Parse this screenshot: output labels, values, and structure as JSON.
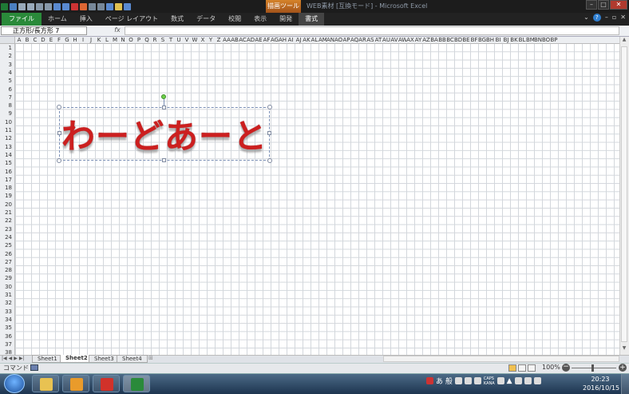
{
  "window": {
    "title": "WEB素材 [互換モード] - Microsoft Excel",
    "context_tab": "描画ツール"
  },
  "ribbon_tabs": [
    "ファイル",
    "ホーム",
    "挿入",
    "ページ レイアウト",
    "数式",
    "データ",
    "校閲",
    "表示",
    "開発",
    "書式"
  ],
  "formula_bar": {
    "name_box": "正方形/長方形 7",
    "fx": "fx",
    "value": ""
  },
  "columns": [
    "A",
    "B",
    "C",
    "D",
    "E",
    "F",
    "G",
    "H",
    "I",
    "J",
    "K",
    "L",
    "M",
    "N",
    "O",
    "P",
    "Q",
    "R",
    "S",
    "T",
    "U",
    "V",
    "W",
    "X",
    "Y",
    "Z",
    "AA",
    "AB",
    "AC",
    "AD",
    "AE",
    "AF",
    "AG",
    "AH",
    "AI",
    "AJ",
    "AK",
    "AL",
    "AM",
    "AN",
    "AO",
    "AP",
    "AQ",
    "AR",
    "AS",
    "AT",
    "AU",
    "AV",
    "AW",
    "AX",
    "AY",
    "AZ",
    "BA",
    "BB",
    "BC",
    "BD",
    "BE",
    "BF",
    "BG",
    "BH",
    "BI",
    "BJ",
    "BK",
    "BL",
    "BM",
    "BN",
    "BO",
    "BP"
  ],
  "rows": [
    "1",
    "2",
    "3",
    "4",
    "5",
    "6",
    "7",
    "8",
    "9",
    "10",
    "11",
    "12",
    "13",
    "14",
    "15",
    "16",
    "17",
    "18",
    "19",
    "20",
    "21",
    "22",
    "23",
    "24",
    "25",
    "26",
    "27",
    "28",
    "29",
    "30",
    "31",
    "32",
    "33",
    "34",
    "35",
    "36",
    "37",
    "38"
  ],
  "wordart": {
    "text": "わーどあーと",
    "color": "#cc1f1f"
  },
  "sheet_tabs": [
    "Sheet1",
    "Sheet2",
    "Sheet3",
    "Sheet4"
  ],
  "active_sheet": "Sheet2",
  "status": {
    "mode": "コマンド",
    "zoom": "100%"
  },
  "taskbar": {
    "time": "20:23",
    "date": "2016/10/15",
    "ime": "あ 般",
    "caps": "CAPS",
    "kana": "KANA"
  }
}
